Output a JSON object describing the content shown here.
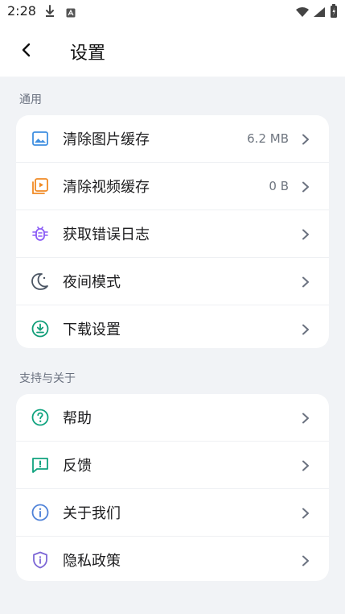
{
  "status_bar": {
    "time": "2:28"
  },
  "header": {
    "title": "设置"
  },
  "sections": [
    {
      "title": "通用",
      "items": [
        {
          "label": "清除图片缓存",
          "value": "6.2 MB"
        },
        {
          "label": "清除视频缓存",
          "value": "0 B"
        },
        {
          "label": "获取错误日志"
        },
        {
          "label": "夜间模式"
        },
        {
          "label": "下载设置"
        }
      ]
    },
    {
      "title": "支持与关于",
      "items": [
        {
          "label": "帮助"
        },
        {
          "label": "反馈"
        },
        {
          "label": "关于我们"
        },
        {
          "label": "隐私政策"
        }
      ]
    }
  ],
  "icons": {
    "image": "image-icon",
    "video": "video-icon",
    "bug": "bug-icon",
    "night": "moon-icon",
    "download": "download-icon",
    "help": "help-icon",
    "feedback": "feedback-icon",
    "about": "info-icon",
    "privacy": "shield-icon"
  },
  "colors": {
    "page_bg": "#f1f3f6",
    "card_bg": "#ffffff",
    "section_title": "#6b7280",
    "chevron": "#6b7280",
    "image_icon": "#3f8fe0",
    "video_icon": "#f08a24",
    "bug_icon": "#8b5cf6",
    "night_icon": "#4b5563",
    "download_icon": "#0f9d77",
    "help_icon": "#10a37f",
    "feedback_icon": "#10a37f",
    "info_icon": "#4f82d8",
    "shield_icon": "#7c66d6"
  }
}
